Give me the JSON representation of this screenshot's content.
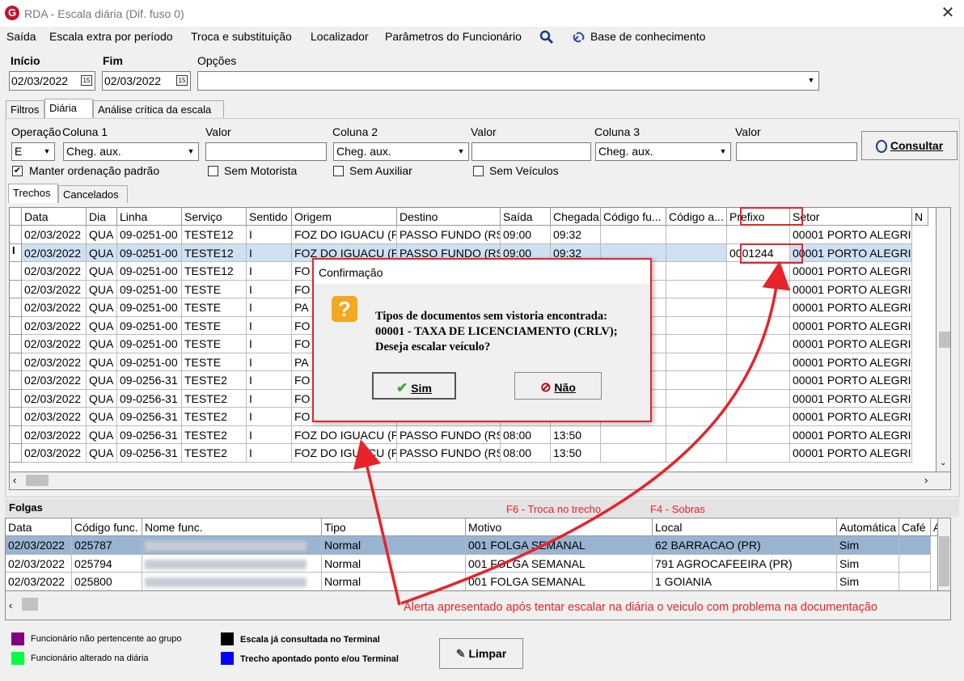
{
  "window": {
    "title": "RDA - Escala diária (Dif. fuso 0)",
    "close": "✕",
    "logo": "G"
  },
  "menu": [
    "Saída",
    "Escala extra por período",
    "Troca e substituição",
    "Localizador",
    "Parâmetros do Funcionário",
    "Base de conhecimento"
  ],
  "filters": {
    "inicio_label": "Início",
    "fim_label": "Fim",
    "opcoes_label": "Opções",
    "inicio_value": "02/03/2022",
    "fim_value": "02/03/2022",
    "opcoes_value": "",
    "cal_icon": "15"
  },
  "main_tabs": [
    "Filtros",
    "Diária",
    "Análise crítica da escala"
  ],
  "query": {
    "operacao_label": "Operação",
    "coluna1_label": "Coluna 1",
    "valor1_label": "Valor",
    "coluna2_label": "Coluna 2",
    "valor2_label": "Valor",
    "coluna3_label": "Coluna 3",
    "valor3_label": "Valor",
    "operacao_value": "E",
    "coluna1_value": "Cheg. aux.",
    "coluna2_value": "Cheg. aux.",
    "coluna3_value": "Cheg. aux.",
    "manter_label": "Manter ordenação padrão",
    "sem_motorista_label": "Sem Motorista",
    "sem_auxiliar_label": "Sem Auxiliar",
    "sem_veiculos_label": "Sem Veículos",
    "consultar_label": "Consultar"
  },
  "sub_tabs": [
    "Trechos",
    "Cancelados"
  ],
  "trechos": {
    "columns": [
      "Data",
      "Dia",
      "Linha",
      "Serviço",
      "Sentido",
      "Origem",
      "Destino",
      "Saída",
      "Chegada",
      "Código fu...",
      "Código a...",
      "Prefixo",
      "Setor",
      "N"
    ],
    "rows": [
      [
        "02/03/2022",
        "QUA",
        "09-0251-00",
        "TESTE12",
        "I",
        "FOZ DO IGUACU (P",
        "PASSO FUNDO (RS",
        "09:00",
        "09:32",
        "",
        "",
        "",
        "00001 PORTO ALEGRI"
      ],
      [
        "02/03/2022",
        "QUA",
        "09-0251-00",
        "TESTE12",
        "I",
        "FOZ DO IGUACU (P",
        "PASSO FUNDO (RS",
        "09:00",
        "09:32",
        "",
        "",
        "0001244",
        "00001 PORTO ALEGRI"
      ],
      [
        "02/03/2022",
        "QUA",
        "09-0251-00",
        "TESTE12",
        "I",
        "FO",
        "",
        "",
        "",
        "",
        "",
        "",
        "00001 PORTO ALEGRI"
      ],
      [
        "02/03/2022",
        "QUA",
        "09-0251-00",
        "TESTE",
        "I",
        "FO",
        "",
        "",
        "",
        "",
        "",
        "",
        "00001 PORTO ALEGRI"
      ],
      [
        "02/03/2022",
        "QUA",
        "09-0251-00",
        "TESTE",
        "I",
        "PA",
        "",
        "",
        "",
        "",
        "",
        "",
        "00001 PORTO ALEGRI"
      ],
      [
        "02/03/2022",
        "QUA",
        "09-0251-00",
        "TESTE",
        "I",
        "FO",
        "",
        "",
        "",
        "",
        "",
        "",
        "00001 PORTO ALEGRI"
      ],
      [
        "02/03/2022",
        "QUA",
        "09-0251-00",
        "TESTE",
        "I",
        "FO",
        "",
        "",
        "",
        "",
        "",
        "",
        "00001 PORTO ALEGRI"
      ],
      [
        "02/03/2022",
        "QUA",
        "09-0251-00",
        "TESTE",
        "I",
        "PA",
        "",
        "",
        "",
        "",
        "",
        "",
        "00001 PORTO ALEGRI"
      ],
      [
        "02/03/2022",
        "QUA",
        "09-0256-31",
        "TESTE2",
        "I",
        "FO",
        "",
        "",
        "",
        "",
        "",
        "",
        "00001 PORTO ALEGRI"
      ],
      [
        "02/03/2022",
        "QUA",
        "09-0256-31",
        "TESTE2",
        "I",
        "FO",
        "",
        "",
        "",
        "",
        "",
        "",
        "00001 PORTO ALEGRI"
      ],
      [
        "02/03/2022",
        "QUA",
        "09-0256-31",
        "TESTE2",
        "I",
        "FO",
        "",
        "",
        "",
        "",
        "",
        "",
        "00001 PORTO ALEGRI"
      ],
      [
        "02/03/2022",
        "QUA",
        "09-0256-31",
        "TESTE2",
        "I",
        "FOZ DO IGUACU (P",
        "PASSO FUNDO (RS",
        "08:00",
        "13:50",
        "",
        "",
        "",
        "00001 PORTO ALEGRI"
      ],
      [
        "02/03/2022",
        "QUA",
        "09-0256-31",
        "TESTE2",
        "I",
        "FOZ DO IGUACU (P",
        "PASSO FUNDO (RS",
        "08:00",
        "13:50",
        "",
        "",
        "",
        "00001 PORTO ALEGRI"
      ]
    ],
    "row_marker": "I"
  },
  "dialog": {
    "title": "Confirmação",
    "icon": "?",
    "line1": "Tipos de documentos sem vistoria encontrada:",
    "line2": "00001 - TAXA DE LICENCIAMENTO (CRLV);",
    "line3": "Deseja escalar veículo?",
    "sim_label": "Sim",
    "nao_label": "Não"
  },
  "folgas": {
    "title": "Folgas",
    "shortcut_f6": "F6 - Troca no trecho",
    "shortcut_f4": "F4 - Sobras",
    "columns": [
      "Data",
      "Código func.",
      "Nome func.",
      "Tipo",
      "Motivo",
      "Local",
      "Automática",
      "Café",
      "A"
    ],
    "rows": [
      [
        "02/03/2022",
        "025787",
        "",
        "Normal",
        "001 FOLGA SEMANAL",
        "62 BARRACAO (PR)",
        "Sim",
        ""
      ],
      [
        "02/03/2022",
        "025794",
        "",
        "Normal",
        "001 FOLGA SEMANAL",
        "791 AGROCAFEEIRA (PR)",
        "Sim",
        ""
      ],
      [
        "02/03/2022",
        "025800",
        "",
        "Normal",
        "001 FOLGA SEMANAL",
        "1 GOIANIA",
        "Sim",
        ""
      ]
    ]
  },
  "annotation": "Alerta apresentado após tentar escalar na diária o veiculo com problema na documentação",
  "legend": {
    "item1": "Funcionário não pertencente ao grupo",
    "item2": "Funcionário alterado na diária",
    "item3": "Escala já consultada no Terminal",
    "item4": "Trecho apontado ponto e/ou Terminal",
    "limpar_label": "Limpar"
  },
  "colors": {
    "purple": "#800080",
    "green": "#00ff40",
    "black": "#000000",
    "blue": "#0000ff",
    "highlight": "#cfe0f3",
    "selected": "#99b4d1",
    "alert": "#e8232a"
  }
}
